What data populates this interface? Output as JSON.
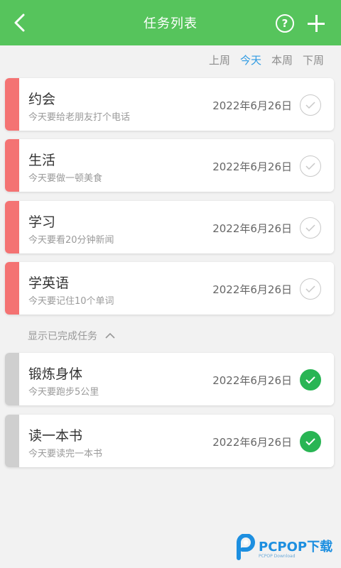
{
  "header": {
    "title": "任务列表",
    "help_label": "?",
    "color": "#56c45c"
  },
  "week_tabs": [
    {
      "label": "上周",
      "active": false
    },
    {
      "label": "今天",
      "active": true
    },
    {
      "label": "本周",
      "active": false
    },
    {
      "label": "下周",
      "active": false
    }
  ],
  "pending_tasks": [
    {
      "title": "约会",
      "desc": "今天要给老朋友打个电话",
      "date": "2022年6月26日",
      "done": false
    },
    {
      "title": "生活",
      "desc": "今天要做一顿美食",
      "date": "2022年6月26日",
      "done": false
    },
    {
      "title": "学习",
      "desc": "今天要看20分钟新闻",
      "date": "2022年6月26日",
      "done": false
    },
    {
      "title": "学英语",
      "desc": "今天要记住10个单词",
      "date": "2022年6月26日",
      "done": false
    }
  ],
  "show_done": {
    "label": "显示已完成任务"
  },
  "done_tasks": [
    {
      "title": "锻炼身体",
      "desc": "今天要跑步5公里",
      "date": "2022年6月26日",
      "done": true
    },
    {
      "title": "读一本书",
      "desc": "今天要读完一本书",
      "date": "2022年6月26日",
      "done": true
    }
  ],
  "watermark": {
    "brand": "PCPOP下载",
    "sub": "PCPOP Download"
  },
  "colors": {
    "accent": "#56c45c",
    "active_tab": "#2f9be3",
    "pending_stripe": "#f47373",
    "done_stripe": "#cfcfcf",
    "checked": "#29b554"
  }
}
